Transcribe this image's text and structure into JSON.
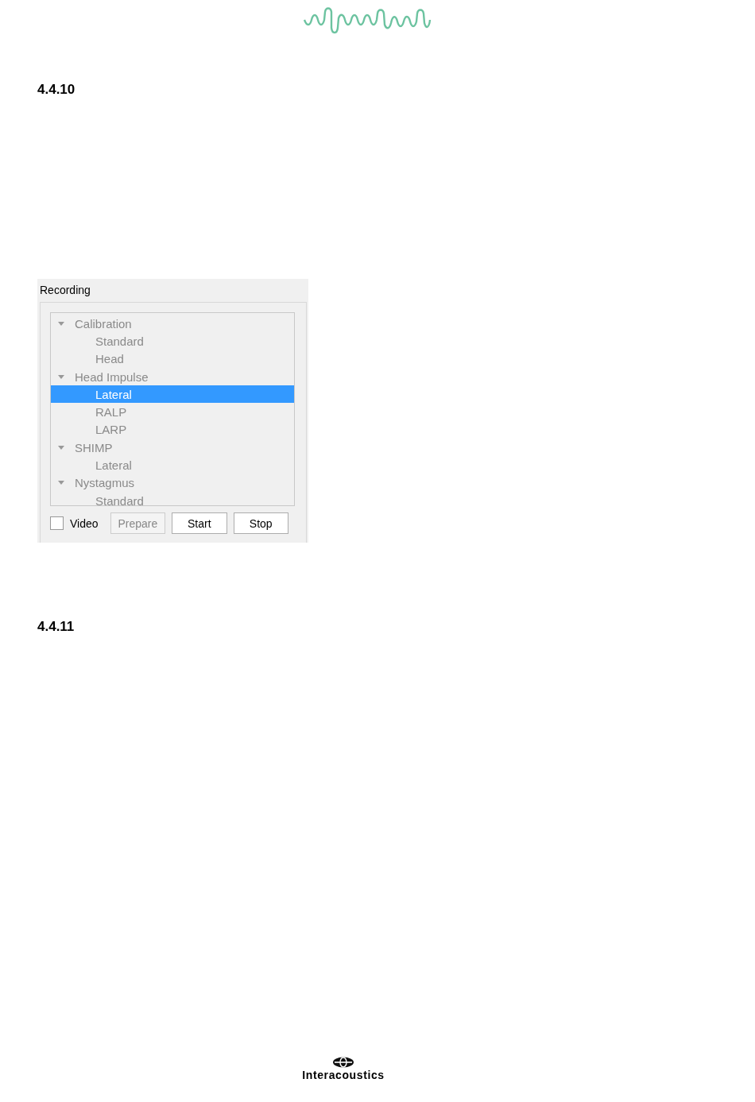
{
  "headings": [
    "4.4.10",
    "4.4.11"
  ],
  "recording_panel": {
    "title": "Recording",
    "tree": [
      {
        "label": "Calibration",
        "expanded": true,
        "selected": false,
        "children": [
          {
            "label": "Standard",
            "selected": false
          },
          {
            "label": "Head",
            "selected": false
          }
        ]
      },
      {
        "label": "Head Impulse",
        "expanded": true,
        "selected": false,
        "children": [
          {
            "label": "Lateral",
            "selected": true
          },
          {
            "label": "RALP",
            "selected": false
          },
          {
            "label": "LARP",
            "selected": false
          }
        ]
      },
      {
        "label": "SHIMP",
        "expanded": true,
        "selected": false,
        "children": [
          {
            "label": "Lateral",
            "selected": false
          }
        ]
      },
      {
        "label": "Nystagmus",
        "expanded": true,
        "selected": false,
        "children": [
          {
            "label": "Standard",
            "selected": false
          }
        ]
      }
    ],
    "video": {
      "label": "Video",
      "checked": false
    },
    "buttons": [
      {
        "label": "Prepare",
        "disabled": true
      },
      {
        "label": "Start",
        "disabled": false
      },
      {
        "label": "Stop",
        "disabled": false
      }
    ]
  },
  "footer": {
    "brand": "Interacoustics"
  }
}
